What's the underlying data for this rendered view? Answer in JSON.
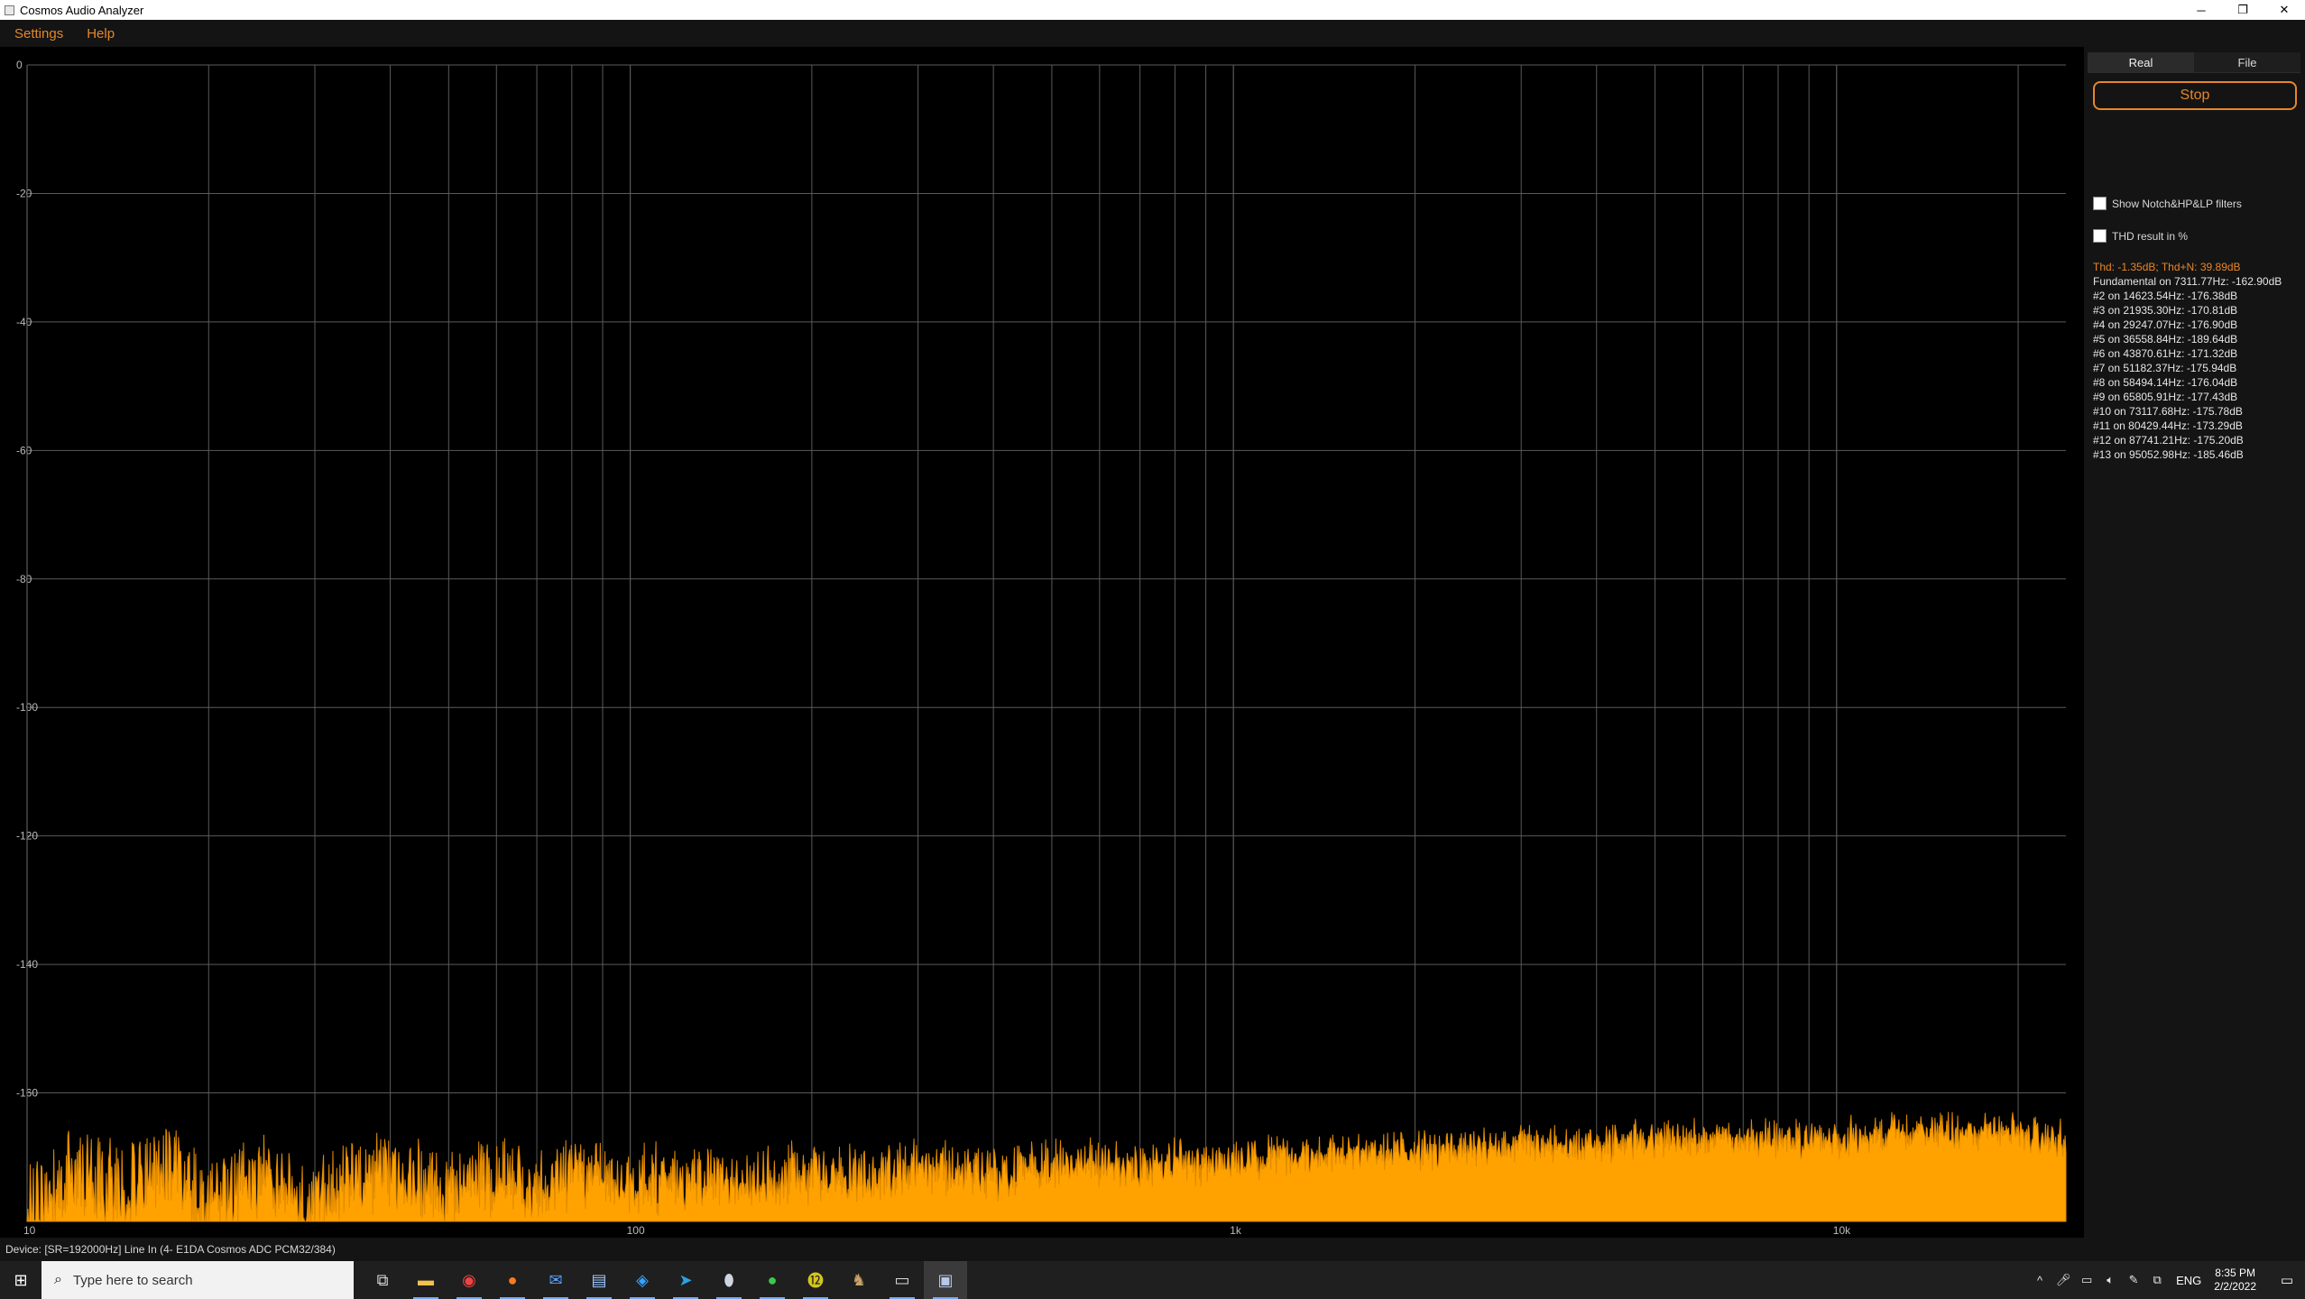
{
  "window": {
    "title": "Cosmos Audio Analyzer",
    "minimize": "─",
    "restore": "❐",
    "close": "✕"
  },
  "menu": {
    "settings": "Settings",
    "help": "Help"
  },
  "colors": {
    "accent": "#e6862a",
    "spectrum_fill": "#ffa200",
    "grid": "#5a5a5a",
    "background": "#000000",
    "panel": "#141414"
  },
  "panel": {
    "tabs": [
      "Real",
      "File"
    ],
    "active_tab": "Real",
    "stop_label": "Stop",
    "show_filters_label": "Show Notch&HP&LP filters",
    "thd_percent_label": "THD result in %",
    "thd_summary": "Thd: -1.35dB; Thd+N: 39.89dB",
    "results": [
      "Fundamental on 7311.77Hz: -162.90dB",
      "#2 on 14623.54Hz: -176.38dB",
      "#3 on 21935.30Hz: -170.81dB",
      "#4 on 29247.07Hz: -176.90dB",
      "#5 on 36558.84Hz: -189.64dB",
      "#6 on 43870.61Hz: -171.32dB",
      "#7 on 51182.37Hz: -175.94dB",
      "#8 on 58494.14Hz: -176.04dB",
      "#9 on 65805.91Hz: -177.43dB",
      "#10 on 73117.68Hz: -175.78dB",
      "#11 on 80429.44Hz: -173.29dB",
      "#12 on 87741.21Hz: -175.20dB",
      "#13 on 95052.98Hz: -185.46dB"
    ]
  },
  "status": {
    "device": "Device: [SR=192000Hz] Line In (4- E1DA Cosmos ADC PCM32/384)"
  },
  "taskbar": {
    "search_placeholder": "Type here to search",
    "lang": "ENG",
    "time": "8:35 PM",
    "date": "2/2/2022",
    "apps": [
      "task-view",
      "file-explorer",
      "chrome",
      "firefox",
      "mail",
      "notepad",
      "compass",
      "telegram",
      "shield",
      "wechat",
      "app-12",
      "animal",
      "terminal",
      "cosmos"
    ]
  },
  "chart_data": {
    "type": "line",
    "x_scale": "log",
    "xlim": [
      10,
      24000
    ],
    "ylim": [
      -180,
      0
    ],
    "x_tick_labels": [
      {
        "value": 10,
        "label": "10"
      },
      {
        "value": 100,
        "label": "100"
      },
      {
        "value": 1000,
        "label": "1k"
      },
      {
        "value": 10000,
        "label": "10k"
      }
    ],
    "y_tick_labels": [
      {
        "value": 0,
        "label": "0"
      },
      {
        "value": -20,
        "label": "-20"
      },
      {
        "value": -40,
        "label": "-40"
      },
      {
        "value": -60,
        "label": "-60"
      },
      {
        "value": -80,
        "label": "-80"
      },
      {
        "value": -100,
        "label": "-100"
      },
      {
        "value": -120,
        "label": "-120"
      },
      {
        "value": -140,
        "label": "-140"
      },
      {
        "value": -160,
        "label": "-160"
      }
    ],
    "grid": true,
    "series": [
      {
        "x": [
          10,
          12,
          14,
          17,
          20,
          25,
          30,
          35,
          40,
          50,
          60,
          70,
          80,
          100,
          130,
          160,
          200,
          250,
          300,
          400,
          500,
          700,
          1000,
          1500,
          2000,
          3000,
          4000,
          5000,
          7000,
          10000,
          14000,
          18000,
          22000,
          24000
        ],
        "y": [
          -174,
          -167,
          -170,
          -166,
          -172,
          -169,
          -173,
          -170,
          -168,
          -172,
          -169,
          -172,
          -169,
          -171,
          -170,
          -171,
          -170,
          -171,
          -170,
          -171,
          -170,
          -170,
          -170,
          -169,
          -169,
          -168,
          -168,
          -167,
          -167,
          -167,
          -166,
          -166,
          -166.5,
          -167
        ]
      }
    ]
  }
}
